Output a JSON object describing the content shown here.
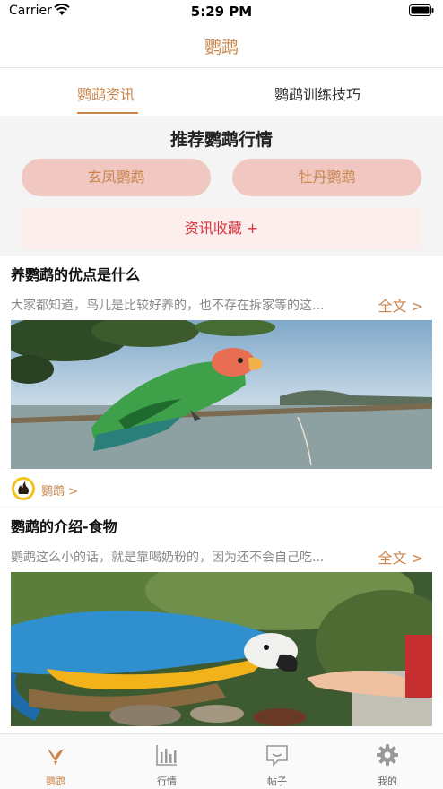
{
  "status_bar": {
    "carrier": "Carrier",
    "time": "5:29 PM"
  },
  "nav": {
    "title": "鹦鹉"
  },
  "tabs": [
    {
      "label": "鹦鹉资讯",
      "active": true
    },
    {
      "label": "鹦鹉训练技巧",
      "active": false
    }
  ],
  "recommend": {
    "title": "推荐鹦鹉行情",
    "pills": [
      "玄凤鹦鹉",
      "牡丹鹦鹉"
    ],
    "favorites_label": "资讯收藏 +"
  },
  "articles": [
    {
      "title": "养鹦鹉的优点是什么",
      "summary": "大家都知道，鸟儿是比较好养的，也不存在拆家等的这...",
      "fulltext_label": "全文 >",
      "image_icon": "lovebird-photo",
      "source_label": "鹦鹉 >"
    },
    {
      "title": "鹦鹉的介绍-食物",
      "summary": "鹦鹉这么小的话，就是靠喝奶粉的，因为还不会自己吃...",
      "fulltext_label": "全文 >",
      "image_icon": "macaw-photo"
    }
  ],
  "bottom_tabs": [
    {
      "label": "鹦鹉",
      "icon": "bird-icon",
      "active": true
    },
    {
      "label": "行情",
      "icon": "chart-icon",
      "active": false
    },
    {
      "label": "帖子",
      "icon": "chat-icon",
      "active": false
    },
    {
      "label": "我的",
      "icon": "gear-icon",
      "active": false
    }
  ],
  "colors": {
    "accent": "#c8864d",
    "pill_bg": "#f1c7c1",
    "fav_text": "#d9333d"
  }
}
